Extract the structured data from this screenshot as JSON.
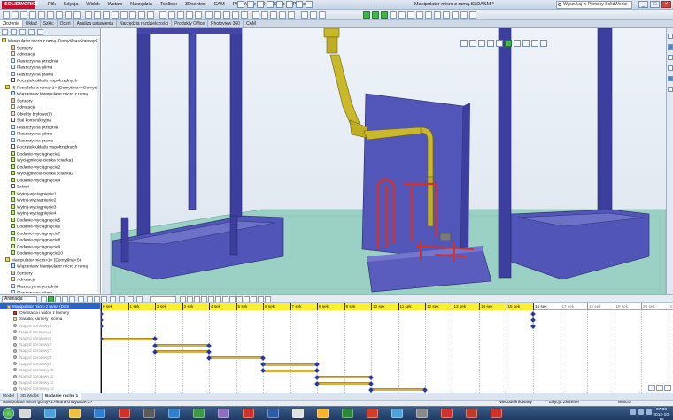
{
  "window": {
    "app_logo": "SOLIDWORKS",
    "menus": [
      "Plik",
      "Edycja",
      "Widok",
      "Wstaw",
      "Narzędzia",
      "Toolbox",
      "3Dcontrol",
      "CAM",
      "PhotoView 360",
      "Okno",
      "Pomoc"
    ],
    "document_title": "Manipulator micro z ramą.SLDASM *",
    "help_search_placeholder": "Wyszukaj w Pomocy SolidWorks",
    "minimize": "_",
    "maximize": "□",
    "close": "×"
  },
  "command_tabs": [
    "Złożenie",
    "Układ",
    "Szkic",
    "Oceń",
    "Analiza ustawienia",
    "Narzędzia rozdzielczości",
    "Produkty Office",
    "Photoview 360",
    "CAM"
  ],
  "feature_tree": [
    {
      "label": "Manipulator micro z ramą (Domyślna<Stan wyś",
      "icon": "part-icon",
      "kind": "part"
    },
    {
      "label": "Sensory",
      "icon": "sensor-icon",
      "kind": "sensor"
    },
    {
      "label": "Adnotacje",
      "icon": "annotation-icon",
      "kind": "annot"
    },
    {
      "label": "Płaszczyzna przednia",
      "icon": "plane-icon",
      "kind": "plane"
    },
    {
      "label": "Płaszczyzna górna",
      "icon": "plane-icon",
      "kind": "plane"
    },
    {
      "label": "Płaszczyzna prawa",
      "icon": "plane-icon",
      "kind": "plane"
    },
    {
      "label": "Początek układu współrzędnych",
      "icon": "origin-icon",
      "kind": "origin"
    },
    {
      "label": "(f) Posadzka z ramą<1> (Domyślna<<Domyś",
      "icon": "part-icon",
      "kind": "part"
    },
    {
      "label": "Wiązania w Manipulator micro z ramą",
      "icon": "mate-icon",
      "kind": "mate"
    },
    {
      "label": "Sensory",
      "icon": "sensor-icon",
      "kind": "sensor"
    },
    {
      "label": "Adnotacje",
      "icon": "annotation-icon",
      "kind": "annot"
    },
    {
      "label": "Obiekty bryłowe(9)",
      "icon": "solid-bodies-icon",
      "kind": "annot"
    },
    {
      "label": "Stal konstrukcyjna",
      "icon": "material-icon",
      "kind": "origin"
    },
    {
      "label": "Płaszczyzna przednia",
      "icon": "plane-icon",
      "kind": "plane"
    },
    {
      "label": "Płaszczyzna górna",
      "icon": "plane-icon",
      "kind": "plane"
    },
    {
      "label": "Płaszczyzna prawa",
      "icon": "plane-icon",
      "kind": "plane"
    },
    {
      "label": "Początek układu współrzędnych",
      "icon": "origin-icon",
      "kind": "origin"
    },
    {
      "label": "Dodanie-wyciągnięcie1",
      "icon": "feature-icon",
      "kind": "feature"
    },
    {
      "label": "Wyciągnięcie-cienka ścianka1",
      "icon": "feature-icon",
      "kind": "feature"
    },
    {
      "label": "Dodanie-wyciągnięcie2",
      "icon": "feature-icon",
      "kind": "feature"
    },
    {
      "label": "Wyciągnięcie-cienka ścianka2",
      "icon": "feature-icon",
      "kind": "feature"
    },
    {
      "label": "Dodanie-wyciągnięcie4",
      "icon": "feature-icon",
      "kind": "feature"
    },
    {
      "label": "Szkic4",
      "icon": "sketch-icon",
      "kind": "origin"
    },
    {
      "label": "Wytnij-wyciągnięcie1",
      "icon": "feature-icon",
      "kind": "feature"
    },
    {
      "label": "Wytnij-wyciągnięcie2",
      "icon": "feature-icon",
      "kind": "feature"
    },
    {
      "label": "Wytnij-wyciągnięcie3",
      "icon": "feature-icon",
      "kind": "feature"
    },
    {
      "label": "Wytnij-wyciągnięcie4",
      "icon": "feature-icon",
      "kind": "feature"
    },
    {
      "label": "Dodanie-wyciągnięcie5",
      "icon": "feature-icon",
      "kind": "feature"
    },
    {
      "label": "Dodanie-wyciągnięcie6",
      "icon": "feature-icon",
      "kind": "feature"
    },
    {
      "label": "Dodanie-wyciągnięcie7",
      "icon": "feature-icon",
      "kind": "feature"
    },
    {
      "label": "Dodanie-wyciągnięcie8",
      "icon": "feature-icon",
      "kind": "feature"
    },
    {
      "label": "Dodanie-wyciągnięcie9",
      "icon": "feature-icon",
      "kind": "feature"
    },
    {
      "label": "Dodanie-wyciągnięcie10",
      "icon": "feature-icon",
      "kind": "feature"
    },
    {
      "label": "Manipulator micro<1> (Domyślna<St",
      "icon": "part-icon",
      "kind": "part"
    },
    {
      "label": "Wiązania w Manipulator micro z ramą",
      "icon": "mate-icon",
      "kind": "mate"
    },
    {
      "label": "Sensory",
      "icon": "sensor-icon",
      "kind": "sensor"
    },
    {
      "label": "Adnotacje",
      "icon": "annotation-icon",
      "kind": "annot"
    },
    {
      "label": "Płaszczyzna przednia",
      "icon": "plane-icon",
      "kind": "plane"
    },
    {
      "label": "Płaszczyzna górna",
      "icon": "plane-icon",
      "kind": "plane"
    }
  ],
  "motion_study": {
    "study_type": "Animacja",
    "tree": [
      {
        "label": "Manipulator micro z ramą (Dom",
        "kind": "sel"
      },
      {
        "label": "Orientacja i widok z kamery",
        "kind": "red"
      },
      {
        "label": "Światła, kamery i scena",
        "kind": "light"
      },
      {
        "label": "Napęd obrotowy3",
        "kind": "dim"
      },
      {
        "label": "Napęd obrotowy4",
        "kind": "dim"
      },
      {
        "label": "Napęd obrotowy5",
        "kind": "dim"
      },
      {
        "label": "Napęd obrotowy6",
        "kind": "dim"
      },
      {
        "label": "Napęd obrotowy7",
        "kind": "dim"
      },
      {
        "label": "Napęd obrotowy8",
        "kind": "dim"
      },
      {
        "label": "Napęd obrotowy9",
        "kind": "dim"
      },
      {
        "label": "Napęd obrotowy10",
        "kind": "dim"
      },
      {
        "label": "Napęd obrotowy11",
        "kind": "dim"
      },
      {
        "label": "Napęd obrotowy12",
        "kind": "dim"
      },
      {
        "label": "Napęd obrotowy13",
        "kind": "dim"
      }
    ],
    "time_labels": [
      "0 sek",
      "1 sek",
      "2 sek",
      "3 sek",
      "4 sek",
      "5 sek",
      "6 sek",
      "7 sek",
      "8 sek",
      "9 sek",
      "10 sek",
      "11 sek",
      "12 sek",
      "13 sek",
      "14 sek",
      "15 sek",
      "16 sek",
      "17 sek",
      "18 sek",
      "19 sek",
      "20 sek",
      "21 s"
    ],
    "study_duration_sek": 16,
    "playhead_sek": 0,
    "motor_segments": [
      {
        "row": 4,
        "start": 0,
        "end": 2
      },
      {
        "row": 5,
        "start": 2,
        "end": 4
      },
      {
        "row": 6,
        "start": 2,
        "end": 4
      },
      {
        "row": 7,
        "start": 4,
        "end": 6
      },
      {
        "row": 8,
        "start": 6,
        "end": 8
      },
      {
        "row": 9,
        "start": 6,
        "end": 8
      },
      {
        "row": 10,
        "start": 8,
        "end": 10
      },
      {
        "row": 11,
        "start": 8,
        "end": 10
      },
      {
        "row": 12,
        "start": 10,
        "end": 12
      }
    ],
    "bottom_tabs": [
      "Model",
      "3D Widok",
      "Badanie ruchu 1"
    ]
  },
  "status": {
    "left": "Manipulator micro górny<1>/Rura chwytaka<1>",
    "middle": "Niedodefiniowany",
    "edit_mode": "Edycja Złożenie",
    "units": "MMGS"
  },
  "taskbar": {
    "time": "07:30",
    "date": "2012-10-18"
  },
  "colors": {
    "frame": "#3c3f9e",
    "floor": "#9bd0c4",
    "robot": "#c9b82a",
    "gripper": "#d0322a",
    "keyframe": "#2337a8",
    "motor_bar": "#d4b247",
    "ruler_active": "#ffee2e"
  }
}
